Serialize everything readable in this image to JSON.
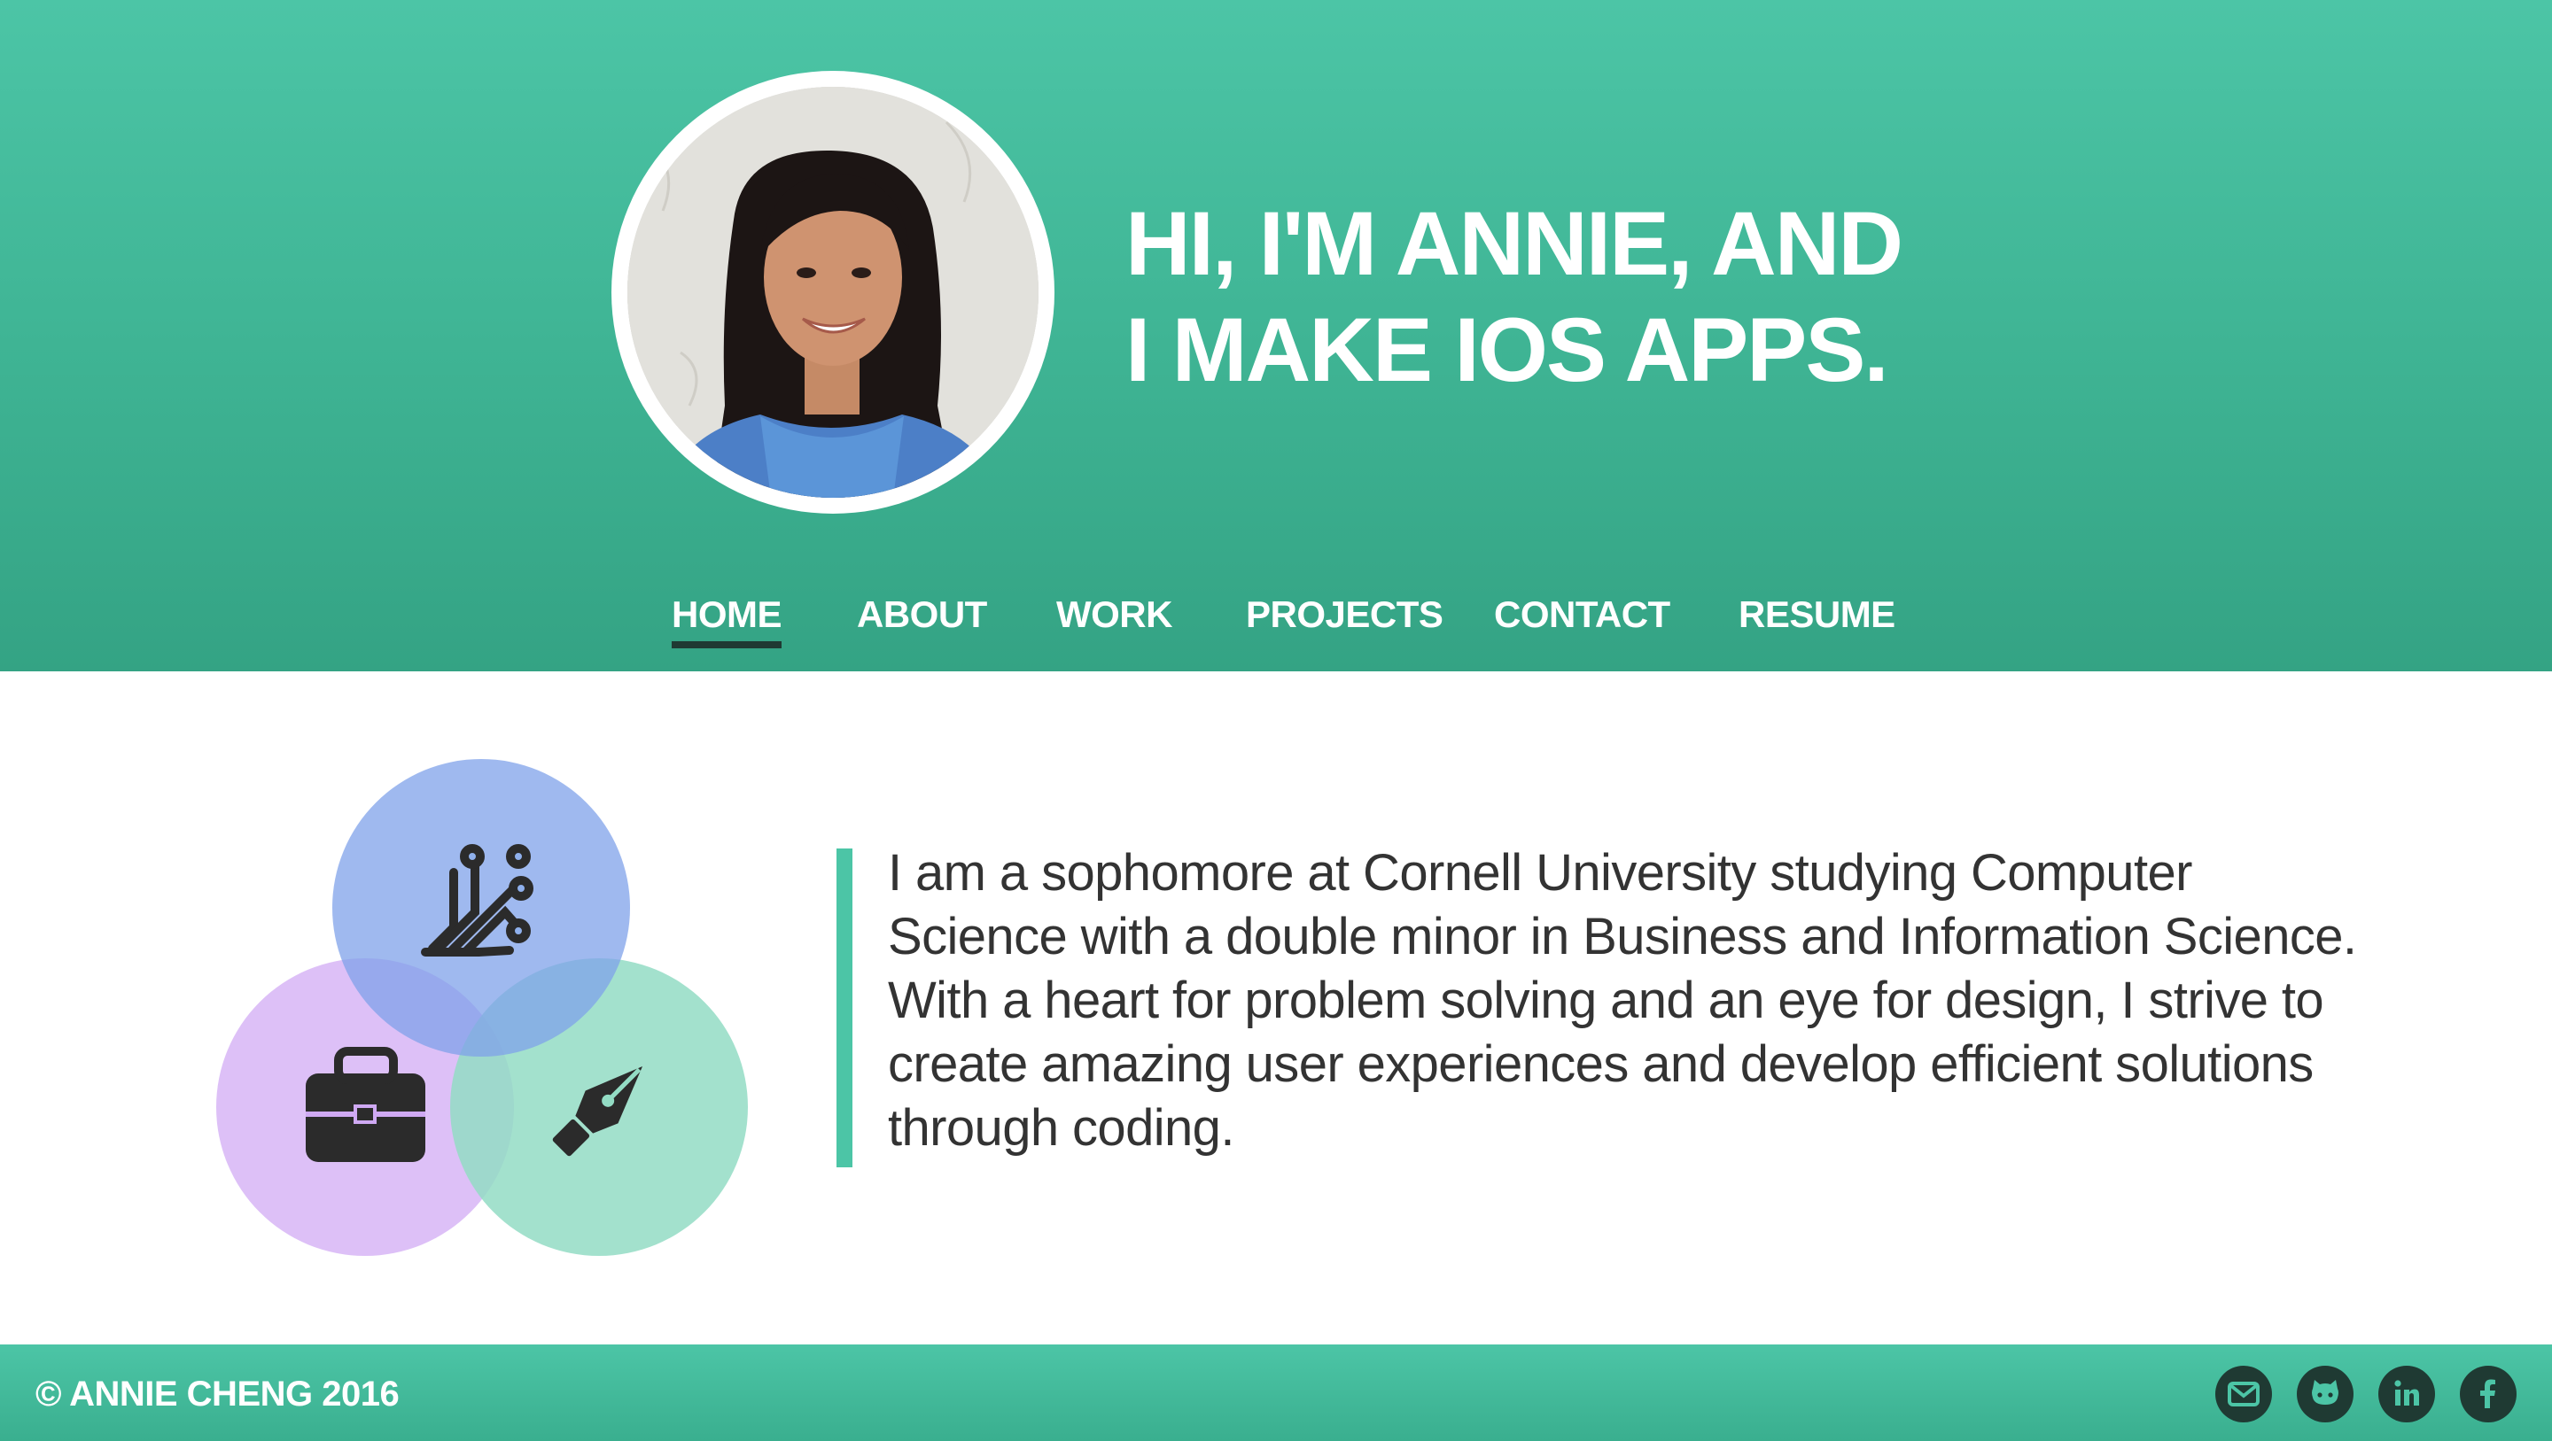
{
  "header": {
    "headline_line1": "HI, I'M ANNIE, AND",
    "headline_line2": "I MAKE IOS APPS.",
    "avatar_alt": "Annie Cheng portrait"
  },
  "nav": {
    "items": [
      {
        "label": "HOME",
        "active": true
      },
      {
        "label": "ABOUT",
        "active": false
      },
      {
        "label": "WORK",
        "active": false
      },
      {
        "label": "PROJECTS",
        "active": false
      },
      {
        "label": "CONTACT",
        "active": false
      },
      {
        "label": "RESUME",
        "active": false
      }
    ]
  },
  "intro": {
    "text": "I am a sophomore at Cornell University studying Computer Science with a double minor in Business and Information Science. With a heart for problem solving and an eye for design, I strive to create amazing user experiences and develop efficient solutions through coding."
  },
  "venn": {
    "icons": [
      "circuit-icon",
      "briefcase-icon",
      "pen-nib-icon"
    ]
  },
  "footer": {
    "copyright": "© ANNIE CHENG 2016",
    "social": [
      "email-icon",
      "github-icon",
      "linkedin-icon",
      "facebook-icon"
    ]
  },
  "colors": {
    "brand_teal": "#4cc5a6",
    "dark_accent": "#1f3a33",
    "body_text": "#333333",
    "venn_blue": "#8fb0ec",
    "venn_purple": "#dcc1f7",
    "venn_green": "#9fe1cc"
  }
}
